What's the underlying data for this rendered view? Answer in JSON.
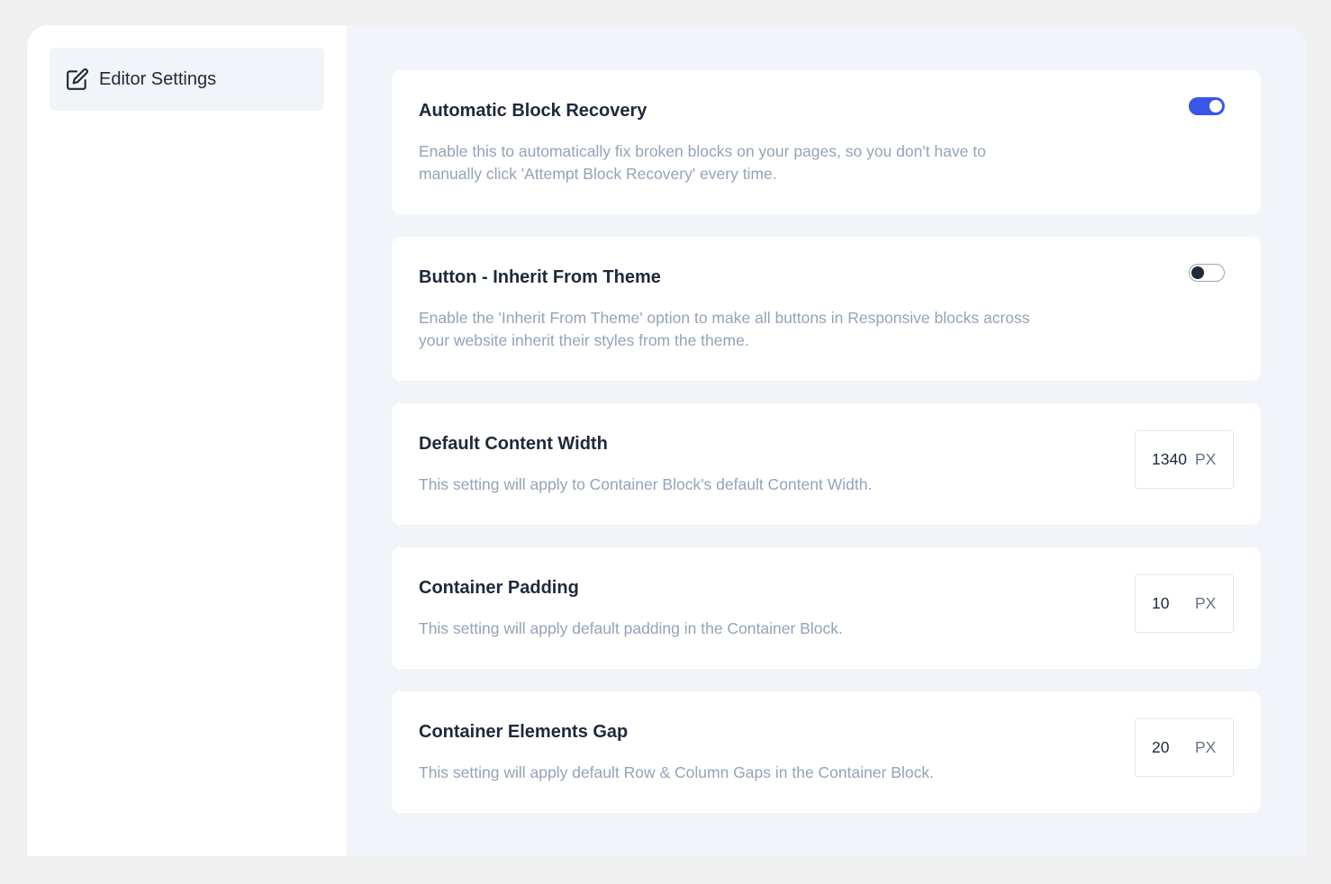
{
  "sidebar": {
    "items": [
      {
        "label": "Editor Settings",
        "icon": "edit-icon"
      }
    ]
  },
  "settings": [
    {
      "title": "Automatic Block Recovery",
      "description": "Enable this to automatically fix broken blocks on your pages, so you don't have to manually click 'Attempt Block Recovery' every time.",
      "control": "toggle",
      "enabled": true
    },
    {
      "title": "Button - Inherit From Theme",
      "description": "Enable the 'Inherit From Theme' option to make all buttons in Responsive blocks across your website inherit their styles from the theme.",
      "control": "toggle",
      "enabled": false
    },
    {
      "title": "Default Content Width",
      "description": "This setting will apply to Container Block's default Content Width.",
      "control": "number",
      "value": "1340",
      "unit": "PX"
    },
    {
      "title": "Container Padding",
      "description": "This setting will apply default padding in the Container Block.",
      "control": "number",
      "value": "10",
      "unit": "PX"
    },
    {
      "title": "Container Elements Gap",
      "description": "This setting will apply default Row & Column Gaps in the Container Block.",
      "control": "number",
      "value": "20",
      "unit": "PX"
    }
  ],
  "colors": {
    "accent": "#3b55e6",
    "background": "#f1f5f9",
    "text": "#1e293b",
    "muted": "#94a3b8"
  }
}
